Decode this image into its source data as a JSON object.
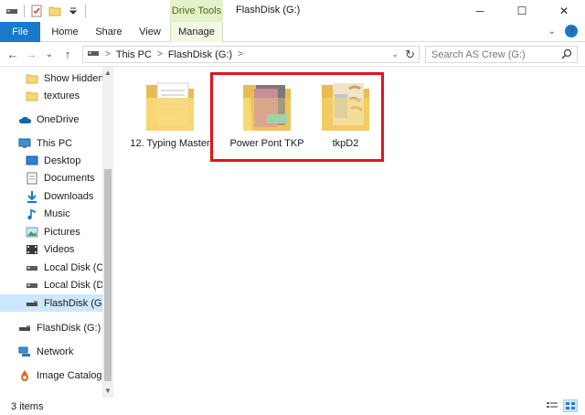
{
  "window": {
    "title": "FlashDisk (G:)",
    "contextual_group": "Drive Tools",
    "controls": {
      "minimize": "─",
      "maximize": "☐",
      "close": "✕"
    }
  },
  "ribbon": {
    "tabs": [
      {
        "label": "File"
      },
      {
        "label": "Home"
      },
      {
        "label": "Share"
      },
      {
        "label": "View"
      },
      {
        "label": "Manage"
      }
    ],
    "expand_glyph": "⌄",
    "help_glyph": "?"
  },
  "nav": {
    "back": "←",
    "forward": "→",
    "recent": "⌄",
    "up": "↑",
    "breadcrumb": [
      "This PC",
      "FlashDisk (G:)"
    ],
    "breadcrumb_sep": ">",
    "refresh": "↻",
    "search_placeholder": "Search AS Crew (G:)"
  },
  "sidebar": {
    "items": [
      {
        "label": "Show Hidden F",
        "icon": "folder-icon"
      },
      {
        "label": "textures",
        "icon": "folder-icon"
      },
      {
        "label": "OneDrive",
        "icon": "onedrive-icon"
      },
      {
        "label": "This PC",
        "icon": "this-pc-icon"
      },
      {
        "label": "Desktop",
        "icon": "desktop-icon"
      },
      {
        "label": "Documents",
        "icon": "documents-icon"
      },
      {
        "label": "Downloads",
        "icon": "downloads-icon"
      },
      {
        "label": "Music",
        "icon": "music-icon"
      },
      {
        "label": "Pictures",
        "icon": "pictures-icon"
      },
      {
        "label": "Videos",
        "icon": "videos-icon"
      },
      {
        "label": "Local Disk (C:)",
        "icon": "drive-icon"
      },
      {
        "label": "Local Disk (D:)",
        "icon": "drive-icon"
      },
      {
        "label": "FlashDisk (G:)",
        "icon": "usb-drive-icon",
        "selected": true
      },
      {
        "label": "FlashDisk (G:)",
        "icon": "usb-drive-icon"
      },
      {
        "label": "Network",
        "icon": "network-icon"
      },
      {
        "label": "Image Catalog",
        "icon": "image-catalog-icon"
      }
    ]
  },
  "files": [
    {
      "name": "12. Typing Master",
      "icon": "folder-documents-icon"
    },
    {
      "name": "Power Pont TKP",
      "icon": "folder-pink-icon"
    },
    {
      "name": "tkpD2",
      "icon": "folder-image-icon"
    }
  ],
  "status": {
    "item_count": "3 items"
  },
  "colors": {
    "accent": "#1979ca",
    "selection": "#cce8ff",
    "highlight_border": "#e0141e",
    "folder": "#f8d775",
    "context_tab": "#e5f1c8"
  }
}
